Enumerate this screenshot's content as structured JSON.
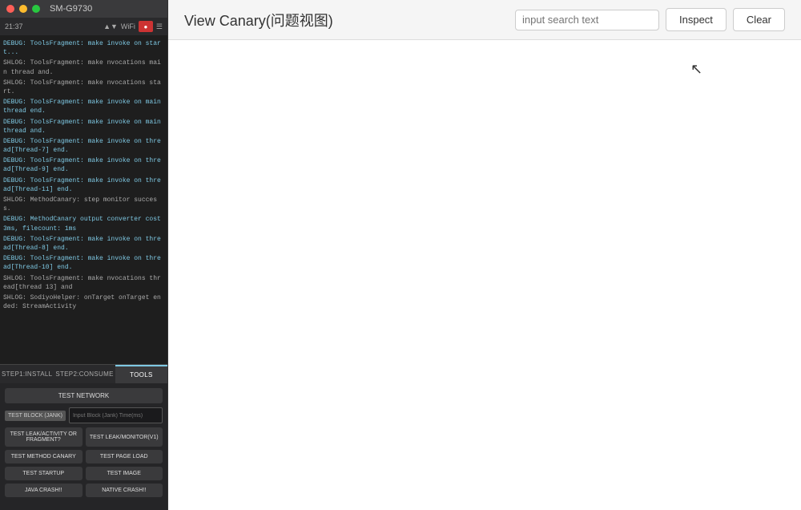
{
  "titleBar": {
    "deviceName": "SM-G9730"
  },
  "statusBar": {
    "time": "21:37",
    "signal": "▲",
    "wifi": "WiFi",
    "battery": "●"
  },
  "logs": [
    {
      "type": "debug",
      "text": "DEBUG: ToolsFragment: make invoke on start..."
    },
    {
      "type": "info",
      "text": "SHLOG: ToolsFragment: make nvocations main thread and."
    },
    {
      "type": "info",
      "text": "SHLOG: ToolsFragment: make nvocations start."
    },
    {
      "type": "debug",
      "text": "DEBUG: ToolsFragment: make invoke on main thread end."
    },
    {
      "type": "debug",
      "text": "DEBUG: ToolsFragment: make invoke on main thread and."
    },
    {
      "type": "debug",
      "text": "DEBUG: ToolsFragment: make invoke on thread[Thread-7] end."
    },
    {
      "type": "debug",
      "text": "DEBUG: ToolsFragment: make invoke on thread[Thread-9] end."
    },
    {
      "type": "debug",
      "text": "DEBUG: ToolsFragment: make invoke on thread[Thread-11] end."
    },
    {
      "type": "info",
      "text": "SHLOG: MethodCanary: step monitor success."
    },
    {
      "type": "debug",
      "text": "DEBUG: MethodCanary output converter cost 3ms, filecount: 1ms"
    },
    {
      "type": "debug",
      "text": "DEBUG: ToolsFragment: make invoke on thread[Thread-8] end."
    },
    {
      "type": "debug",
      "text": "DEBUG: ToolsFragment: make invoke on thread[Thread-10] end."
    },
    {
      "type": "info",
      "text": "SHLOG: ToolsFragment: make nvocations thread[thread 13] and"
    },
    {
      "type": "info",
      "text": "SHLOG: SodiyoHelper: onTarget onTarget ended: StreamActivity"
    }
  ],
  "tabs": [
    {
      "label": "STEP1:INSTALL",
      "active": false
    },
    {
      "label": "STEP2:CONSUME",
      "active": false
    },
    {
      "label": "TOOLS",
      "active": true
    }
  ],
  "tools": {
    "testNetworkLabel": "TEST NETWORK",
    "blockLeakLabel": "TEST BLOCK (JANK)",
    "blockInputPlaceholder": "Input Block (Jank) Time(ms)",
    "buttons": [
      {
        "label": "TEST LEAK/ACTIVITY OR FRAGMENT?"
      },
      {
        "label": "TEST LEAK/MONITOR(V1)"
      },
      {
        "label": "TEST METHOD CANARY"
      },
      {
        "label": "TEST PAGE LOAD"
      },
      {
        "label": "TEST STARTUP"
      },
      {
        "label": "TEST IMAGE"
      },
      {
        "label": "JAVA CRASH!!"
      },
      {
        "label": "NATIVE CRASH!!"
      }
    ]
  },
  "header": {
    "title": "View Canary(问题视图)",
    "searchPlaceholder": "input search text",
    "inspectLabel": "Inspect",
    "clearLabel": "Clear"
  }
}
